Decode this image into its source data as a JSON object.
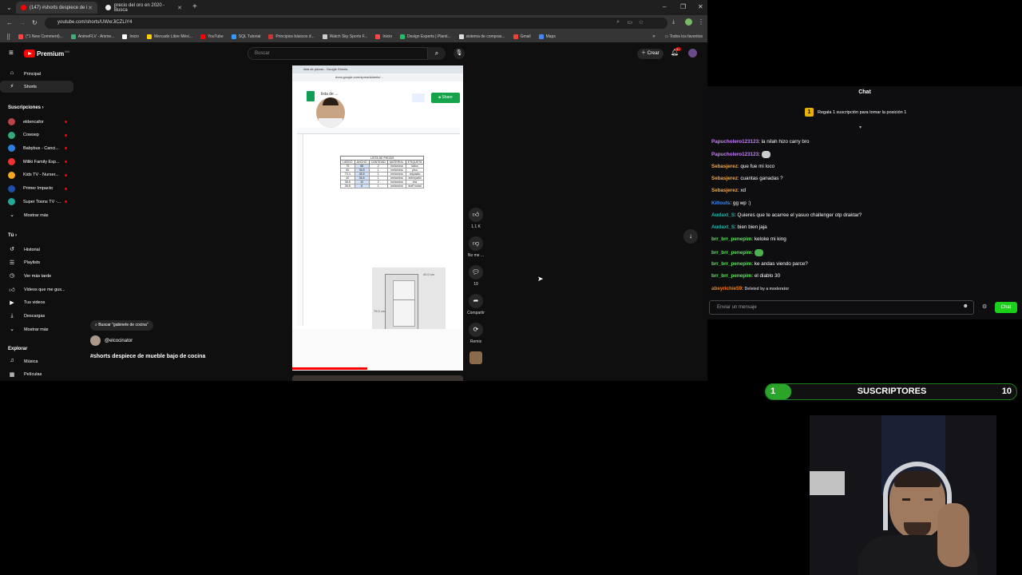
{
  "browser": {
    "tabs": [
      {
        "title": "(147) #shorts despiece de i",
        "active": true
      },
      {
        "title": "precio del oro en 2020 - Busca",
        "active": false
      }
    ],
    "url": "youtube.com/shorts/UWxrJiCZLiY4",
    "bookmarks": [
      "(*1 New Comment)...",
      "AnimeFLV - Anime...",
      "Inicio",
      "Mercado Libre Méxi...",
      "YouTube",
      "SQL Tutorial",
      "Principios básicos d...",
      "Watch Sky Sports F...",
      "Inicio",
      "Design Experts | Planti...",
      "sistema de compras...",
      "Gmail",
      "Maps"
    ],
    "all_bookmarks": "Todos los favoritos"
  },
  "youtube": {
    "logo_text": "Premium",
    "logo_sup": "MX",
    "search_placeholder": "Buscar",
    "create_label": "Crear",
    "notif_count": "9+",
    "sidebar": {
      "principal": "Principal",
      "shorts": "Shorts",
      "subs_header": "Suscripciones",
      "subs": [
        {
          "name": "eldencafor",
          "color": "#b44"
        },
        {
          "name": "Cowsep",
          "color": "#3a7"
        },
        {
          "name": "Babybus - Canci...",
          "color": "#2c7fe0"
        },
        {
          "name": "Miliki Family Esp...",
          "color": "#e33"
        },
        {
          "name": "Kids TV - Nurser...",
          "color": "#f5a623"
        },
        {
          "name": "Primer Impacto",
          "color": "#1d4fa8"
        },
        {
          "name": "Super Toons TV -...",
          "color": "#2a9"
        }
      ],
      "show_more": "Mostrar más",
      "you_header": "Tú",
      "you_items": [
        "Historial",
        "Playlists",
        "Ver más tarde",
        "Videos que me gus...",
        "Tus videos",
        "Descargas",
        "Mostrar más"
      ],
      "explore_header": "Explorar",
      "explore_items": [
        "Música",
        "Películas"
      ]
    },
    "short": {
      "search_chip": "Buscar \"gabinete de cocina\"",
      "channel": "@elcocinator",
      "title": "#shorts despiece de mueble bajo de cocina",
      "likes": "1.1 K",
      "dislike_label": "No me ...",
      "comments": "19",
      "share_label": "Compartir",
      "remix_label": "Remix"
    },
    "sheet": {
      "tab_title": "lista de piezas - Google Sheets",
      "url": "docs.google.com/spreadsheets/...",
      "doc_title": "lista de ...",
      "share": "Share",
      "table_title": "LISTA DE PIEZAS",
      "headers": [
        "LARGO",
        "ANCHO",
        "CANTIDAD",
        "MATERIAL",
        "ETIQUETA"
      ],
      "rows": [
        [
          "75",
          "58",
          "2",
          "melamina",
          "lados"
        ],
        [
          "60",
          "38.5",
          "1",
          "melamina",
          "piso"
        ],
        [
          "73.4",
          "38.6",
          "1",
          "melamina",
          "respaldo"
        ],
        [
          "40",
          "36.6",
          "1",
          "melamina",
          "entrepaño"
        ],
        [
          "38.8",
          "10",
          "2",
          "melamina",
          "tira"
        ],
        [
          "38.8",
          "8",
          "1",
          "melamina",
          "tiraFrontal"
        ]
      ],
      "dims": [
        "40.0 cm",
        "75.0 cm",
        "40.0 cm"
      ]
    }
  },
  "chat": {
    "title": "Chat",
    "pinned": "Regala 1 suscripción para tomar la posición 1",
    "messages": [
      {
        "user": "Papucholero123123",
        "text": "la nilah hizo carry bro",
        "color": "#c77dff"
      },
      {
        "user": "Papucholero123123",
        "text": "",
        "emote": true,
        "color": "#c77dff"
      },
      {
        "user": "Sebasjerez",
        "text": "que fue mi loco",
        "color": "#f3a847"
      },
      {
        "user": "Sebasjerez",
        "text": "cuantas ganadas ?",
        "color": "#f3a847"
      },
      {
        "user": "Sebasjerez",
        "text": "xd",
        "color": "#f3a847"
      },
      {
        "user": "Kiltouts",
        "text": "gg wp :)",
        "color": "#3d8bfd"
      },
      {
        "user": "Audaxt_S",
        "text": "Quieres que te acarree el yasuo challenger otp draktar?",
        "color": "#1fb8a8"
      },
      {
        "user": "Audaxt_S",
        "text": "bien bien jaja",
        "color": "#1fb8a8"
      },
      {
        "user": "brr_brr_penepim",
        "text": "keloke mi king",
        "color": "#5fe05f"
      },
      {
        "user": "brr_brr_penepim",
        "text": "",
        "emote": true,
        "color": "#5fe05f"
      },
      {
        "user": "brr_brr_penepim",
        "text": "ke andas viendo parce?",
        "color": "#5fe05f"
      },
      {
        "user": "brr_brr_penepim",
        "text": "el diablo 30",
        "color": "#5fe05f"
      },
      {
        "user": "abeyrichie59",
        "text": "Deleted by a moderator",
        "color": "#ff7a00",
        "deleted": true
      }
    ],
    "input_placeholder": "Enviar un mensaje",
    "send_label": "Chat"
  },
  "overlay": {
    "subs_count_left": "1",
    "subs_label": "SUSCRIPTORES",
    "subs_goal": "10",
    "subs_progress": 0.1
  }
}
